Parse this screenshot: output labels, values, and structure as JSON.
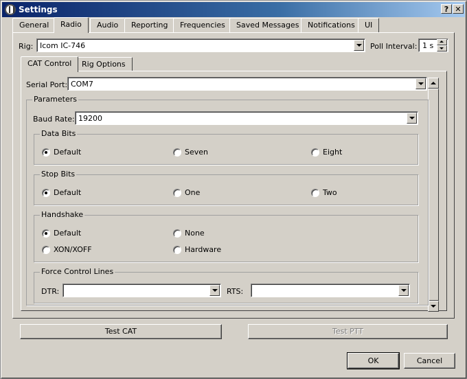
{
  "window": {
    "title": "Settings",
    "help_glyph": "?",
    "close_glyph": "✕"
  },
  "tabs": [
    "General",
    "Radio",
    "Audio",
    "Reporting",
    "Frequencies",
    "Saved Messages",
    "Notifications",
    "UI"
  ],
  "active_tab": "Radio",
  "rig": {
    "label": "Rig:",
    "value": "Icom IC-746"
  },
  "poll_interval": {
    "label": "Poll Interval:",
    "value": "1 s"
  },
  "subtabs": [
    "CAT Control",
    "Rig Options"
  ],
  "cat": {
    "serial_port_label": "Serial Port:",
    "serial_port_value": "COM7",
    "parameters_title": "Parameters",
    "baud_label": "Baud Rate:",
    "baud_value": "19200",
    "data_bits": {
      "title": "Data Bits",
      "options": [
        "Default",
        "Seven",
        "Eight"
      ],
      "selected": "Default"
    },
    "stop_bits": {
      "title": "Stop Bits",
      "options": [
        "Default",
        "One",
        "Two"
      ],
      "selected": "Default"
    },
    "handshake": {
      "title": "Handshake",
      "options": [
        "Default",
        "None",
        "XON/XOFF",
        "Hardware"
      ],
      "selected": "Default"
    },
    "force_lines": {
      "title": "Force Control Lines",
      "dtr_label": "DTR:",
      "dtr_value": "",
      "rts_label": "RTS:",
      "rts_value": ""
    }
  },
  "buttons": {
    "test_cat": "Test CAT",
    "test_ptt": "Test PTT",
    "ok": "OK",
    "cancel": "Cancel"
  }
}
